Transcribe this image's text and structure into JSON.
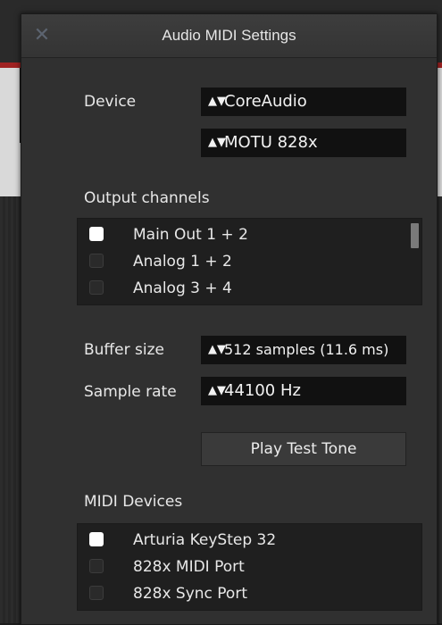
{
  "window": {
    "title": "Audio MIDI Settings",
    "close_glyph": "✕"
  },
  "device": {
    "label": "Device",
    "driver_value": "CoreAudio",
    "interface_value": "MOTU 828x"
  },
  "output_channels": {
    "label": "Output channels",
    "items": [
      {
        "label": "Main Out 1 + 2",
        "checked": true
      },
      {
        "label": "Analog 1 + 2",
        "checked": false
      },
      {
        "label": "Analog 3 + 4",
        "checked": false
      }
    ]
  },
  "buffer": {
    "label": "Buffer size",
    "value": "512 samples (11.6 ms)"
  },
  "sample_rate": {
    "label": "Sample rate",
    "value": "44100 Hz"
  },
  "test_tone": {
    "label": "Play Test Tone"
  },
  "midi_devices": {
    "label": "MIDI Devices",
    "items": [
      {
        "label": "Arturia KeyStep 32",
        "checked": true
      },
      {
        "label": "828x MIDI Port",
        "checked": false
      },
      {
        "label": "828x Sync Port",
        "checked": false
      }
    ]
  },
  "icons": {
    "close": "close-icon",
    "select_arrows": "updown-arrows-icon"
  },
  "colors": {
    "dialog_bg": "#303030",
    "field_bg": "#111111",
    "list_bg": "#1f1f1f",
    "text": "#e8e8e8"
  }
}
